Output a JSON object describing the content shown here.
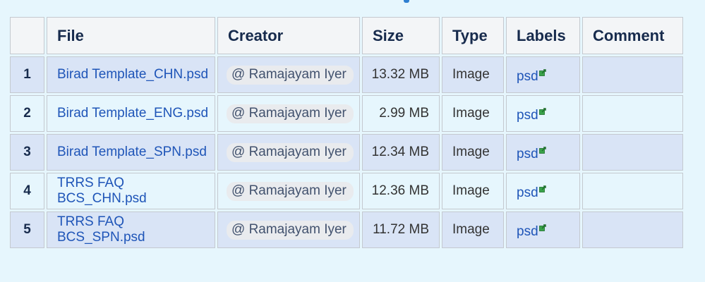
{
  "columns": [
    "",
    "File",
    "Creator",
    "Size",
    "Type",
    "Labels",
    "Comment"
  ],
  "rows": [
    {
      "index": "1",
      "file": "Birad Template_CHN.psd",
      "creator": "@ Ramajayam Iyer",
      "size": "13.32 MB",
      "type": "Image",
      "label": "psd",
      "comment": ""
    },
    {
      "index": "2",
      "file": "Birad Template_ENG.psd",
      "creator": "@ Ramajayam Iyer",
      "size": "2.99 MB",
      "type": "Image",
      "label": "psd",
      "comment": ""
    },
    {
      "index": "3",
      "file": "Birad Template_SPN.psd",
      "creator": "@ Ramajayam Iyer",
      "size": "12.34 MB",
      "type": "Image",
      "label": "psd",
      "comment": ""
    },
    {
      "index": "4",
      "file": "TRRS FAQ BCS_CHN.psd",
      "creator": "@ Ramajayam Iyer",
      "size": "12.36 MB",
      "type": "Image",
      "label": "psd",
      "comment": ""
    },
    {
      "index": "5",
      "file": "TRRS FAQ BCS_SPN.psd",
      "creator": "@ Ramajayam Iyer",
      "size": "11.72 MB",
      "type": "Image",
      "label": "psd",
      "comment": ""
    }
  ],
  "colors": {
    "odd_row": "#d9e4f6",
    "even_row": "#e6f6fd",
    "link": "#1f55b8",
    "header_bg": "#f3f5f7"
  },
  "icons": {
    "label_link": "external-link-icon"
  }
}
